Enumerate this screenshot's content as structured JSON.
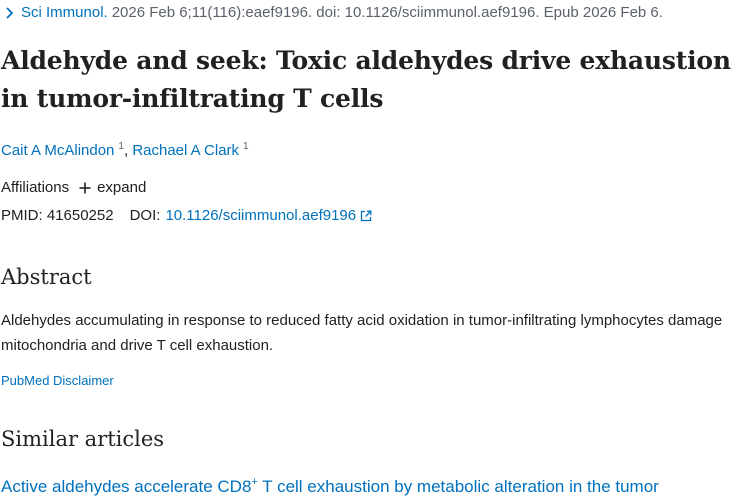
{
  "citation": {
    "journal": "Sci Immunol.",
    "details": "2026 Feb 6;11(116):eaef9196. doi: 10.1126/sciimmunol.aef9196. Epub 2026 Feb 6."
  },
  "article": {
    "title": "Aldehyde and seek: Toxic aldehydes drive exhaustion in tumor-infiltrating T cells",
    "authors": [
      {
        "name": "Cait A McAlindon",
        "affiliation": "1"
      },
      {
        "name": "Rachael A Clark",
        "affiliation": "1"
      }
    ],
    "author_separator": ",",
    "affiliations_label": "Affiliations",
    "expand_label": "expand",
    "pmid_label": "PMID:",
    "pmid": "41650252",
    "doi_label": "DOI:",
    "doi": "10.1126/sciimmunol.aef9196"
  },
  "abstract": {
    "heading": "Abstract",
    "text": "Aldehydes accumulating in response to reduced fatty acid oxidation in tumor-infiltrating lymphocytes damage mitochondria and drive T cell exhaustion."
  },
  "disclaimer": {
    "label": "PubMed Disclaimer"
  },
  "similar_articles": {
    "heading": "Similar articles",
    "items": [
      {
        "title_before": "Active aldehydes accelerate CD8",
        "title_sup": "+",
        "title_after": " T cell exhaustion by metabolic alteration in the tumor"
      }
    ]
  },
  "colors": {
    "link": "#0071bc",
    "text": "#212121",
    "muted": "#5b616b"
  },
  "icons": {
    "citation_toggle": "chevron-right-icon",
    "expand": "plus-icon",
    "external_link": "external-link-icon"
  }
}
